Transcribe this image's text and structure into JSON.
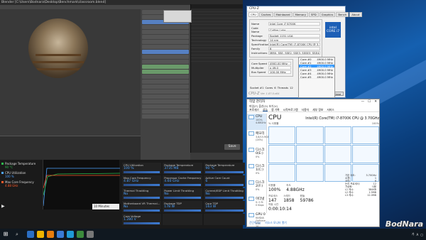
{
  "blender": {
    "title": "Blender [C:\\Users\\Bodnara\\Desktop\\Benchmark\\classroom.blend]",
    "save_label": "Save"
  },
  "xtu": {
    "legend": [
      "Package Temperature",
      "CPU Utilization",
      "Max Core Frequency"
    ],
    "legend_values": [
      "90 °C",
      "100 %",
      "4.88 GHz"
    ],
    "colors": {
      "temp": "#2db84c",
      "util": "#4fa3ff",
      "freq": "#ff5a2a"
    },
    "tiles": [
      {
        "label": "CPU Utilization",
        "value": "100 %"
      },
      {
        "label": "Package Temperature",
        "value": "3735 MB"
      },
      {
        "label": "Package Temperature",
        "value": "90 °C"
      },
      {
        "label": "Max Core Frequency",
        "value": "4.87 GHz"
      },
      {
        "label": "Processor Cache Frequency",
        "value": "4.60 GHz"
      },
      {
        "label": "Active Core Count",
        "value": "6"
      },
      {
        "label": "Thermal Throttling",
        "value": "No"
      },
      {
        "label": "Power Limit Throttling",
        "value": "No"
      },
      {
        "label": "Current/EDP Limit Throttling",
        "value": "No"
      },
      {
        "label": "Motherboard VR Thermal...",
        "value": "No"
      },
      {
        "label": "Package TDP",
        "value": "178 W"
      },
      {
        "label": "Core TDP",
        "value": "163 W"
      },
      {
        "label": "Core Voltage",
        "value": "1.280 V"
      },
      {
        "label": "",
        "value": ""
      },
      {
        "label": "",
        "value": ""
      }
    ],
    "range_option": "10 Minutes",
    "play_icon": "play-icon"
  },
  "cpuz": {
    "title": "CPU-Z",
    "tabs": [
      "CPU",
      "Caches",
      "Mainboard",
      "Memory",
      "SPD",
      "Graphics",
      "Bench",
      "About"
    ],
    "processor": [
      {
        "k": "Name",
        "v": "Intel Core i7 8700K"
      },
      {
        "k": "Code Name",
        "v": "Coffee Lake"
      },
      {
        "k": "Package",
        "v": "Socket 1151 LGA"
      },
      {
        "k": "Technology",
        "v": "14 nm"
      },
      {
        "k": "Specification",
        "v": "Intel(R) Core(TM) i7-8700K CPU @ 3.70GHz"
      },
      {
        "k": "Family",
        "v": "6"
      },
      {
        "k": "Instructions",
        "v": "MMX, SSE, SSE2, SSE3, SSSE3, SSE4.1, SSE4.2, EM64T, VT-x, AES, AVX, AVX2, FMA3"
      }
    ],
    "clocks": [
      {
        "k": "Core Speed",
        "v": "4900.00 MHz"
      },
      {
        "k": "Multiplier",
        "v": "x 49.0"
      },
      {
        "k": "Bus Speed",
        "v": "100.00 MHz"
      }
    ],
    "selection": "Socket #1",
    "cores_label": "Cores",
    "cores_value": "6",
    "threads_label": "Threads",
    "threads_value": "12",
    "version": "CPU-Z",
    "ver_num": "Ver. 1.87.0.x64",
    "tools_label": "Tools",
    "validate_label": "Validate",
    "close_label": "Close",
    "logo_text": "intel CORE i7"
  },
  "core_clocks": [
    {
      "k": "Core #0",
      "v": "4900.0 MHz",
      "hl": false
    },
    {
      "k": "Core #1",
      "v": "4900.0 MHz",
      "hl": false
    },
    {
      "k": "Core #2",
      "v": "4900.0 MHz",
      "hl": true
    },
    {
      "k": "Core #3",
      "v": "4900.0 MHz",
      "hl": false
    },
    {
      "k": "Core #4",
      "v": "4900.0 MHz",
      "hl": false
    },
    {
      "k": "Core #5",
      "v": "4900.0 MHz",
      "hl": false
    }
  ],
  "taskmanager": {
    "title": "작업 관리자",
    "menu": "파일(F)  옵션(O)  보기(V)",
    "tabs": [
      "프로세스",
      "성능",
      "앱 기록",
      "시작프로그램",
      "사용자",
      "세부 정보",
      "서비스"
    ],
    "sidebar": [
      {
        "name": "CPU",
        "sub": "100% 4.88GHz"
      },
      {
        "name": "메모리",
        "sub": "3.8/15.9GB (24%)"
      },
      {
        "name": "디스크 0(E:)",
        "sub": "0%"
      },
      {
        "name": "디스크 1(C:)",
        "sub": "0%"
      },
      {
        "name": "디스크 2(F:)",
        "sub": "0%"
      },
      {
        "name": "이더넷",
        "sub": "S: 0 R: 0 Kbps"
      },
      {
        "name": "GPU 0",
        "sub": "NVIDIA GeForce RTX 20..."
      }
    ],
    "heading": "CPU",
    "cpu_name": "Intel(R) Core(TM) i7-8700K CPU @ 3.70GHz",
    "graph_caption_left": "% 사용률",
    "graph_caption_right": "100%",
    "stats": [
      {
        "label": "이용률",
        "value": "100%"
      },
      {
        "label": "속도",
        "value": "4.88GHz"
      }
    ],
    "stats2": [
      {
        "label": "프로세스",
        "value": "147"
      },
      {
        "label": "스레드",
        "value": "1858"
      },
      {
        "label": "핸들",
        "value": "59786"
      }
    ],
    "uptime_label": "작동 시간",
    "uptime": "0:00:10:14",
    "right_specs": [
      {
        "k": "기본 속도:",
        "v": "3.70GHz"
      },
      {
        "k": "소켓:",
        "v": "1"
      },
      {
        "k": "코어:",
        "v": "6"
      },
      {
        "k": "논리 프로세서:",
        "v": "12"
      },
      {
        "k": "가상화:",
        "v": "사용"
      },
      {
        "k": "L1 캐시:",
        "v": "384KB"
      },
      {
        "k": "L2 캐시:",
        "v": "1.5MB"
      },
      {
        "k": "L3 캐시:",
        "v": "12.0MB"
      }
    ],
    "footer": [
      "간단히(D)",
      "리소스 모니터 열기"
    ]
  },
  "watermark": "BodNara",
  "taskbar": {
    "tray_lang": "A",
    "tray_ime": "가"
  }
}
